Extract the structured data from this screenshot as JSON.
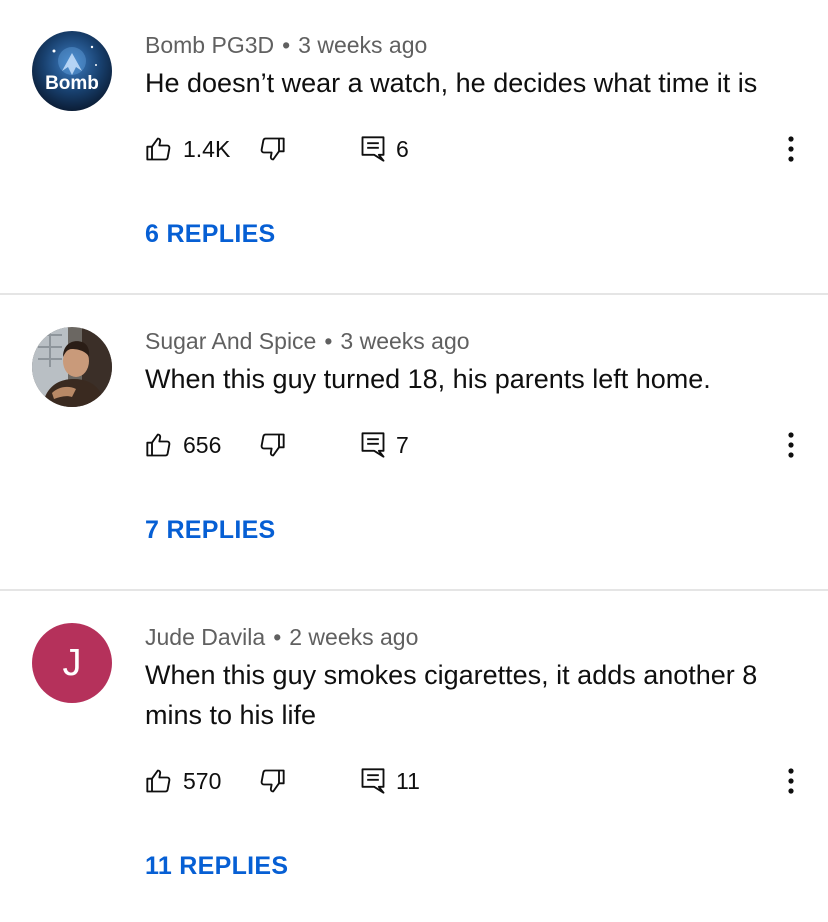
{
  "colors": {
    "link": "#065fd4",
    "meta": "#606060",
    "text": "#0f0f0f",
    "divider": "#e5e5e5",
    "avatar_j": "#b5315b"
  },
  "comments": [
    {
      "author": "Bomb PG3D",
      "separator": "•",
      "time": "3 weeks ago",
      "text": "He doesn’t wear a watch, he decides what time it is",
      "likes": "1.4K",
      "reply_count": "6",
      "replies_label": "6 REPLIES",
      "avatar": {
        "type": "image",
        "overlay_text": "Bomb",
        "icon": "bomb-logo-avatar"
      }
    },
    {
      "author": "Sugar And Spice",
      "separator": "•",
      "time": "3 weeks ago",
      "text": "When this guy turned 18, his parents left home.",
      "likes": "656",
      "reply_count": "7",
      "replies_label": "7 REPLIES",
      "avatar": {
        "type": "image",
        "icon": "man-portrait-avatar"
      }
    },
    {
      "author": "Jude Davila",
      "separator": "•",
      "time": "2 weeks ago",
      "text": "When this guy smokes cigarettes, it adds another 8 mins to his life",
      "likes": "570",
      "reply_count": "11",
      "replies_label": "11 REPLIES",
      "avatar": {
        "type": "letter",
        "letter": "J",
        "color": "#b5315b"
      }
    }
  ],
  "icons": {
    "like": "thumbs-up-icon",
    "dislike": "thumbs-down-icon",
    "reply": "comment-icon",
    "more": "more-vertical-icon"
  }
}
